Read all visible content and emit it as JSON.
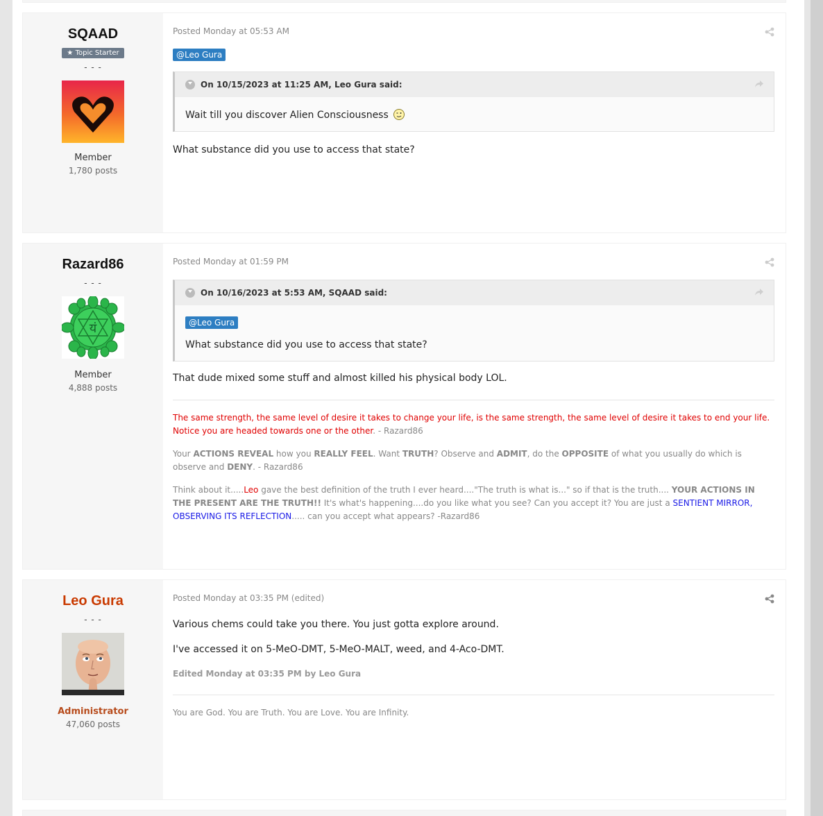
{
  "colors": {
    "accent": "#2d7ec2",
    "admin": "#c93a00",
    "quote_bg": "#ededed",
    "sig_red": "#e00000",
    "sig_blue": "#1a1ae6"
  },
  "posts": [
    {
      "author": "SQAAD",
      "badge": "Topic Starter",
      "dashes": "- - -",
      "role": "Member",
      "post_count": "1,780 posts",
      "posted": "Posted Monday at 05:53 AM",
      "mention": "@Leo Gura",
      "quote_header": "On 10/15/2023 at 11:25 AM, Leo Gura said:",
      "quote_text": "Wait till you discover Alien Consciousness",
      "body": "What substance did you use to access that state?"
    },
    {
      "author": "Razard86",
      "dashes": "- - -",
      "role": "Member",
      "post_count": "4,888 posts",
      "posted": "Posted Monday at 01:59 PM",
      "quote_header": "On 10/16/2023 at 5:53 AM, SQAAD said:",
      "quote_mention": "@Leo Gura",
      "quote_text": "What substance did you use to access that state?",
      "body": "That dude mixed some stuff and almost killed his physical body LOL.",
      "sig1_red": "The same strength, the same level of desire it takes to change your life, is the same strength, the same level of desire it takes to end your life. Notice you are headed towards one or the other",
      "sig1_tail": ". - Razard86",
      "sig2_a": "Your ",
      "sig2_b": "ACTIONS REVEAL",
      "sig2_c": " how you ",
      "sig2_d": "REALLY FEEL",
      "sig2_e": ". Want ",
      "sig2_f": "TRUTH",
      "sig2_g": "? Observe and ",
      "sig2_h": "ADMIT",
      "sig2_i": ", do the ",
      "sig2_j": "OPPOSITE",
      "sig2_k": " of what you usually do which is observe and ",
      "sig2_l": "DENY",
      "sig2_m": ". - Razard86",
      "sig3_a": "Think about it.....",
      "sig3_b": "Leo",
      "sig3_c": " gave the best definition of the truth I ever heard....\"The truth is what is...\" so if that is the truth.... ",
      "sig3_d": "YOUR ACTIONS IN THE PRESENT ARE THE TRUTH!!",
      "sig3_e": " It's what's happening....do you like what you see? Can you accept it? You are just a ",
      "sig3_f": "SENTIENT MIRROR, OBSERVING ITS REFLECTION",
      "sig3_g": "..... can you accept what appears? -Razard86"
    },
    {
      "author": "Leo Gura",
      "dashes": "- - -",
      "role": "Administrator",
      "post_count": "47,060 posts",
      "posted": "Posted Monday at 03:35 PM (edited)",
      "line1": "Various chems could take you there. You just gotta explore around.",
      "line2": "I've accessed it on 5-MeO-DMT, 5-MeO-MALT, weed, and 4-Aco-DMT.",
      "edited": "Edited Monday at 03:35 PM by Leo Gura",
      "sig": "You are God. You are Truth. You are Love. You are Infinity."
    }
  ],
  "icons": [
    "share-icon",
    "chevron-down-icon",
    "quote-share-icon",
    "star-icon",
    "wink-emoji-icon"
  ]
}
